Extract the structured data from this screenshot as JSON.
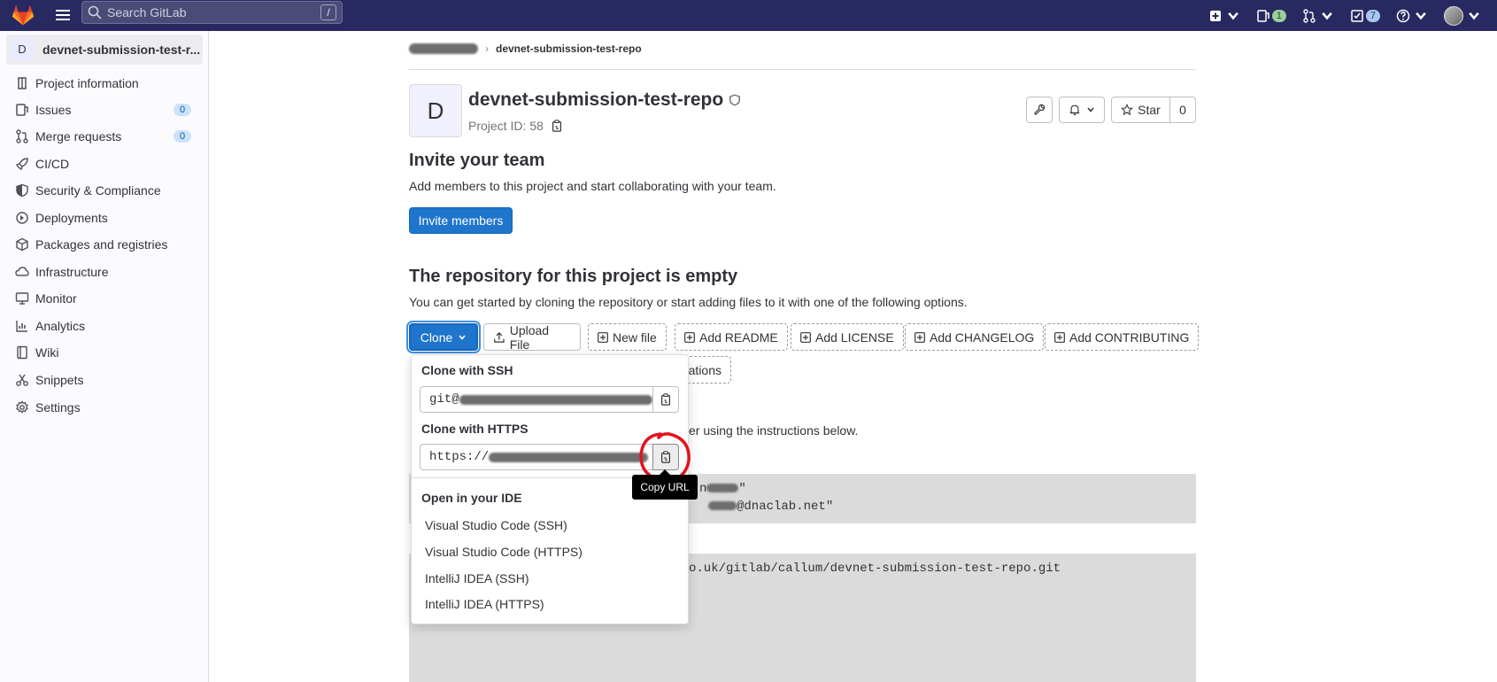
{
  "topbar": {
    "search_placeholder": "Search GitLab",
    "search_shortcut": "/",
    "merge_requests_count": "1",
    "todos_count": "7"
  },
  "sidebar": {
    "project_letter": "D",
    "project_name": "devnet-submission-test-r...",
    "items": [
      {
        "label": "Project information",
        "icon": "project-icon"
      },
      {
        "label": "Issues",
        "icon": "issues-icon",
        "count": "0"
      },
      {
        "label": "Merge requests",
        "icon": "merge-request-icon",
        "count": "0"
      },
      {
        "label": "CI/CD",
        "icon": "rocket-icon"
      },
      {
        "label": "Security & Compliance",
        "icon": "shield-icon"
      },
      {
        "label": "Deployments",
        "icon": "deployments-icon"
      },
      {
        "label": "Packages and registries",
        "icon": "package-icon"
      },
      {
        "label": "Infrastructure",
        "icon": "cloud-icon"
      },
      {
        "label": "Monitor",
        "icon": "monitor-icon"
      },
      {
        "label": "Analytics",
        "icon": "chart-icon"
      },
      {
        "label": "Wiki",
        "icon": "book-icon"
      },
      {
        "label": "Snippets",
        "icon": "snippet-icon"
      },
      {
        "label": "Settings",
        "icon": "gear-icon"
      }
    ]
  },
  "breadcrumb": {
    "current": "devnet-submission-test-repo"
  },
  "project": {
    "letter": "D",
    "title": "devnet-submission-test-repo",
    "id_text": "Project ID: 58",
    "star_label": "Star",
    "star_count": "0"
  },
  "invite": {
    "heading": "Invite your team",
    "text": "Add members to this project and start collaborating with your team.",
    "button": "Invite members"
  },
  "empty": {
    "heading": "The repository for this project is empty",
    "text": "You can get started by cloning the repository or start adding files to it with one of the following options.",
    "clone_label": "Clone",
    "upload_label": "Upload File",
    "new_file_label": "New file",
    "readme_label": "Add README",
    "license_label": "Add LICENSE",
    "changelog_label": "Add CHANGELOG",
    "contributing_label": "Add CONTRIBUTING",
    "integrations_partial": "ations",
    "instructions_partial": "er using the instructions below.",
    "code_line_1_partial": "n",
    "code_line_1_end": "\"",
    "code_line_2_partial": "@dnaclab.net\"",
    "code_line_3_partial": "o.uk/gitlab/callum/devnet-submission-test-repo.git"
  },
  "clone_dropdown": {
    "ssh_heading": "Clone with SSH",
    "ssh_value": "git@",
    "https_heading": "Clone with HTTPS",
    "https_value": "https://",
    "ide_heading": "Open in your IDE",
    "ide_items": [
      "Visual Studio Code (SSH)",
      "Visual Studio Code (HTTPS)",
      "IntelliJ IDEA (SSH)",
      "IntelliJ IDEA (HTTPS)"
    ],
    "tooltip": "Copy URL"
  },
  "colors": {
    "topbar": "#292961",
    "primary": "#1f75cb",
    "annotation": "#e0141e"
  }
}
